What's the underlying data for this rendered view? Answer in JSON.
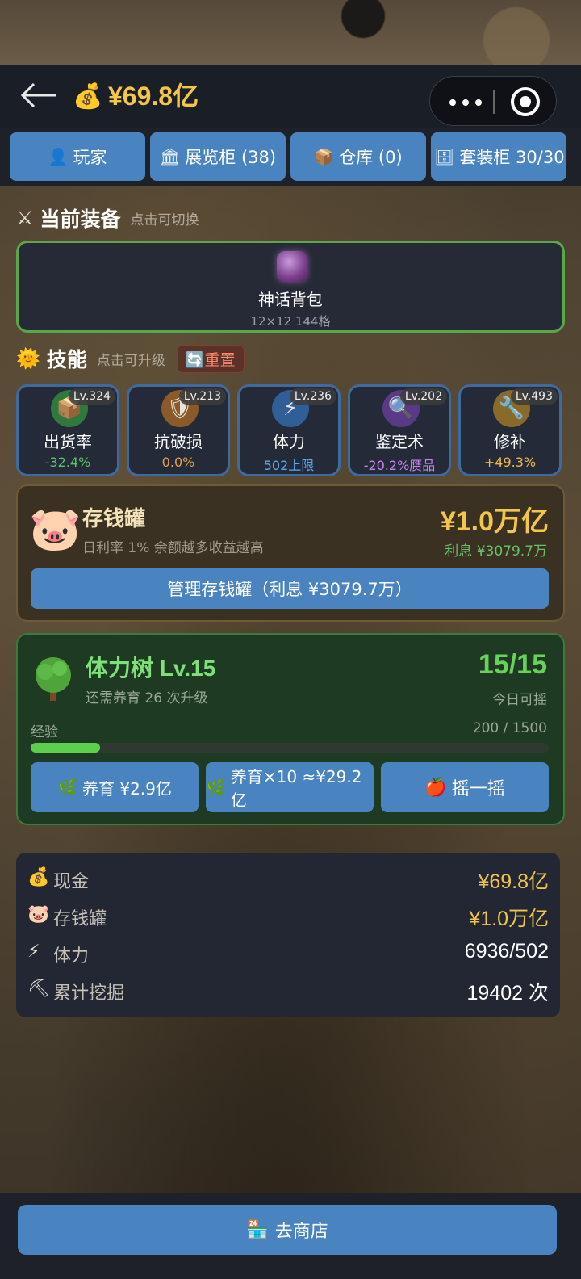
{
  "header": {
    "money_icon": "money-bag-icon",
    "money": "¥69.8亿"
  },
  "tabs": [
    {
      "icon": "👤",
      "label": "玩家"
    },
    {
      "icon": "🏛",
      "label": "展览柜 (38)"
    },
    {
      "icon": "📦",
      "label": "仓库 (0)"
    },
    {
      "icon": "🗄",
      "label": "套装柜 30/30"
    }
  ],
  "equipment": {
    "title": "当前装备",
    "hint": "点击可切换",
    "item_name": "神话背包",
    "item_sub": "12×12 144格"
  },
  "skills_section": {
    "title": "技能",
    "hint": "点击可升级",
    "reset_label": "🔄重置"
  },
  "skills": [
    {
      "name": "出货率",
      "level": "Lv.324",
      "value": "-32.4%",
      "icon": "box-icon",
      "glyph": "📦",
      "icon_bg": "#2e7a3e",
      "value_color": "#5cc46a"
    },
    {
      "name": "抗破损",
      "level": "Lv.213",
      "value": "0.0%",
      "icon": "shield-icon",
      "glyph": "🛡",
      "icon_bg": "#8a5a2a",
      "value_color": "#e0a050"
    },
    {
      "name": "体力",
      "level": "Lv.236",
      "value": "502上限",
      "icon": "lightning-icon",
      "glyph": "⚡",
      "icon_bg": "#2f5f96",
      "value_color": "#5aa8ee"
    },
    {
      "name": "鉴定术",
      "level": "Lv.202",
      "value": "-20.2%赝品",
      "icon": "magnifier-icon",
      "glyph": "🔍",
      "icon_bg": "#5a3a86",
      "value_color": "#c784f0"
    },
    {
      "name": "修补",
      "level": "Lv.493",
      "value": "+49.3%",
      "icon": "wrench-icon",
      "glyph": "🔧",
      "icon_bg": "#8a6a2a",
      "value_color": "#f0b84a"
    }
  ],
  "piggy_bank": {
    "title": "存钱罐",
    "subtitle": "日利率 1%  余额越多收益越高",
    "amount": "¥1.0万亿",
    "interest": "利息 ¥3079.7万",
    "button": "管理存钱罐（利息 ¥3079.7万）"
  },
  "stamina_tree": {
    "title": "体力树  Lv.15",
    "subtitle": "还需养育 26 次升级",
    "count": "15/15",
    "count_label": "今日可摇",
    "exp_label": "经验",
    "exp_value": "200 / 1500",
    "exp_fraction": 0.1333,
    "buttons": [
      {
        "icon": "🌿",
        "label": "养育 ¥2.9亿"
      },
      {
        "icon": "🌿",
        "label": "养育×10 ≈¥29.2亿"
      },
      {
        "icon": "🍎",
        "label": "摇一摇"
      }
    ]
  },
  "stats": [
    {
      "icon": "💰",
      "label": "现金",
      "value": "¥69.8亿",
      "color": "#f3c64a"
    },
    {
      "icon": "🐷",
      "label": "存钱罐",
      "value": "¥1.0万亿",
      "color": "#f3c64a"
    },
    {
      "icon": "⚡",
      "label": "体力",
      "value": "6936/502",
      "color": "#ffffff"
    },
    {
      "icon": "⛏",
      "label": "累计挖掘",
      "value": "19402 次",
      "color": "#ffffff"
    }
  ],
  "bottom": {
    "icon": "🏪",
    "shop_label": "去商店"
  }
}
